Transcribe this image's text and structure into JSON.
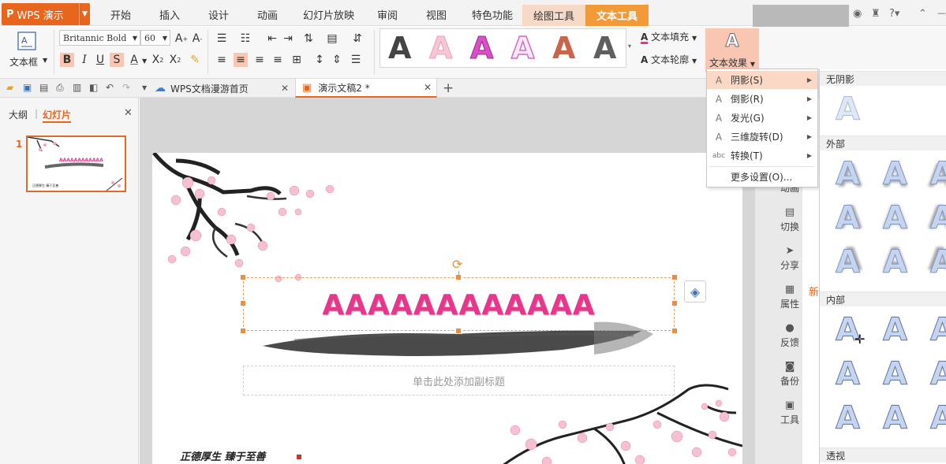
{
  "app": {
    "name": "WPS 演示"
  },
  "menu": {
    "items": [
      "开始",
      "插入",
      "设计",
      "动画",
      "幻灯片放映",
      "审阅",
      "视图",
      "特色功能"
    ],
    "tab_drawing": "绘图工具",
    "tab_text": "文本工具"
  },
  "ribbon": {
    "textbox_label": "文本框",
    "font_name": "Britannic Bold",
    "font_size": "60",
    "styles_count": 6,
    "fill_label": "文本填充",
    "outline_label": "文本轮廓",
    "effects_label": "文本效果",
    "effects_icon": "A",
    "fill_color": "#e8368f",
    "accent_color": "#e8651e"
  },
  "tabs": {
    "home_doc": "WPS文档漫游首页",
    "current_doc": "演示文稿2 *"
  },
  "left_panel": {
    "tab_outline": "大纲",
    "tab_slides": "幻灯片",
    "slide_number": "1"
  },
  "slide": {
    "title_text": "AAAAAAAAAAAA",
    "subtitle_placeholder": "单击此处添加副标题",
    "calligraphy": "正德厚生  臻于至善"
  },
  "sidebar": {
    "items": [
      "动画",
      "切换",
      "分享",
      "属性",
      "反馈",
      "备份",
      "工具"
    ],
    "partial_text": "新"
  },
  "effects_menu": {
    "items": [
      {
        "label": "阴影(S)",
        "icon": "A"
      },
      {
        "label": "倒影(R)",
        "icon": "A"
      },
      {
        "label": "发光(G)",
        "icon": "A"
      },
      {
        "label": "三维旋转(D)",
        "icon": "A"
      },
      {
        "label": "转换(T)",
        "icon": "abc"
      }
    ],
    "more": "更多设置(O)..."
  },
  "shadow_gallery": {
    "sections": [
      "无阴影",
      "外部",
      "内部",
      "透视"
    ],
    "letter": "A"
  }
}
